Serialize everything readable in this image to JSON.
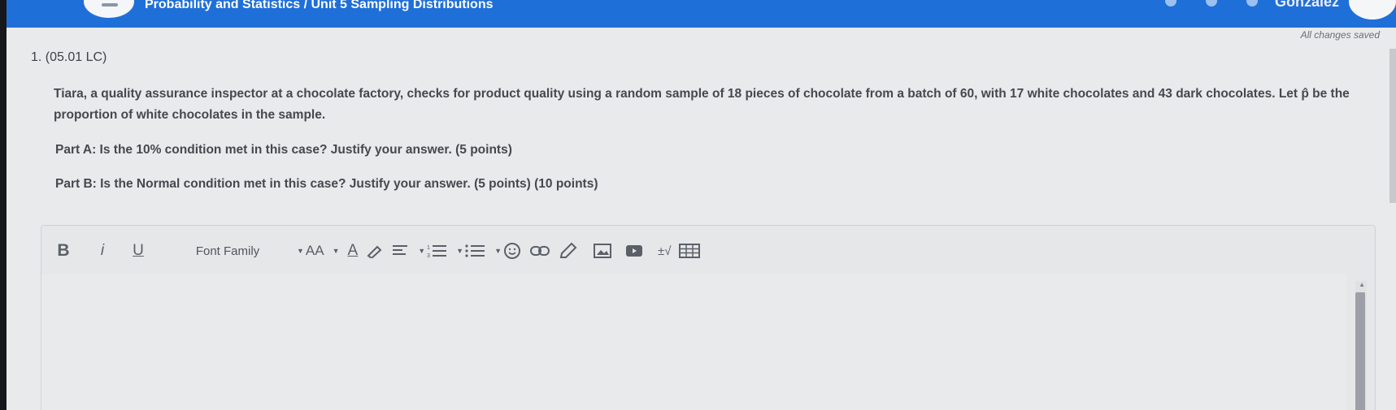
{
  "header": {
    "breadcrumb": "Probability and Statistics / Unit 5 Sampling Distributions",
    "user_name": "Gonzalez"
  },
  "status": {
    "saved": "All changes saved"
  },
  "question": {
    "number": "1. (05.01 LC)",
    "text": "Tiara, a quality assurance inspector at a chocolate factory, checks for product quality using a random sample of 18 pieces of chocolate from a batch of 60, with 17 white chocolates and 43 dark chocolates. Let p̂ be the proportion of white chocolates in the sample.",
    "part_a": "Part A: Is the 10% condition met in this case? Justify your answer. (5 points)",
    "part_b": "Part B: Is the Normal condition met in this case? Justify your answer. (5 points) (10 points)"
  },
  "editor": {
    "bold": "B",
    "italic": "i",
    "underline": "U",
    "font_family": "Font Family",
    "font_size": "AA",
    "font_color": "A",
    "superscript_math": "±√"
  },
  "colors": {
    "accent": "#1f6fd8"
  }
}
